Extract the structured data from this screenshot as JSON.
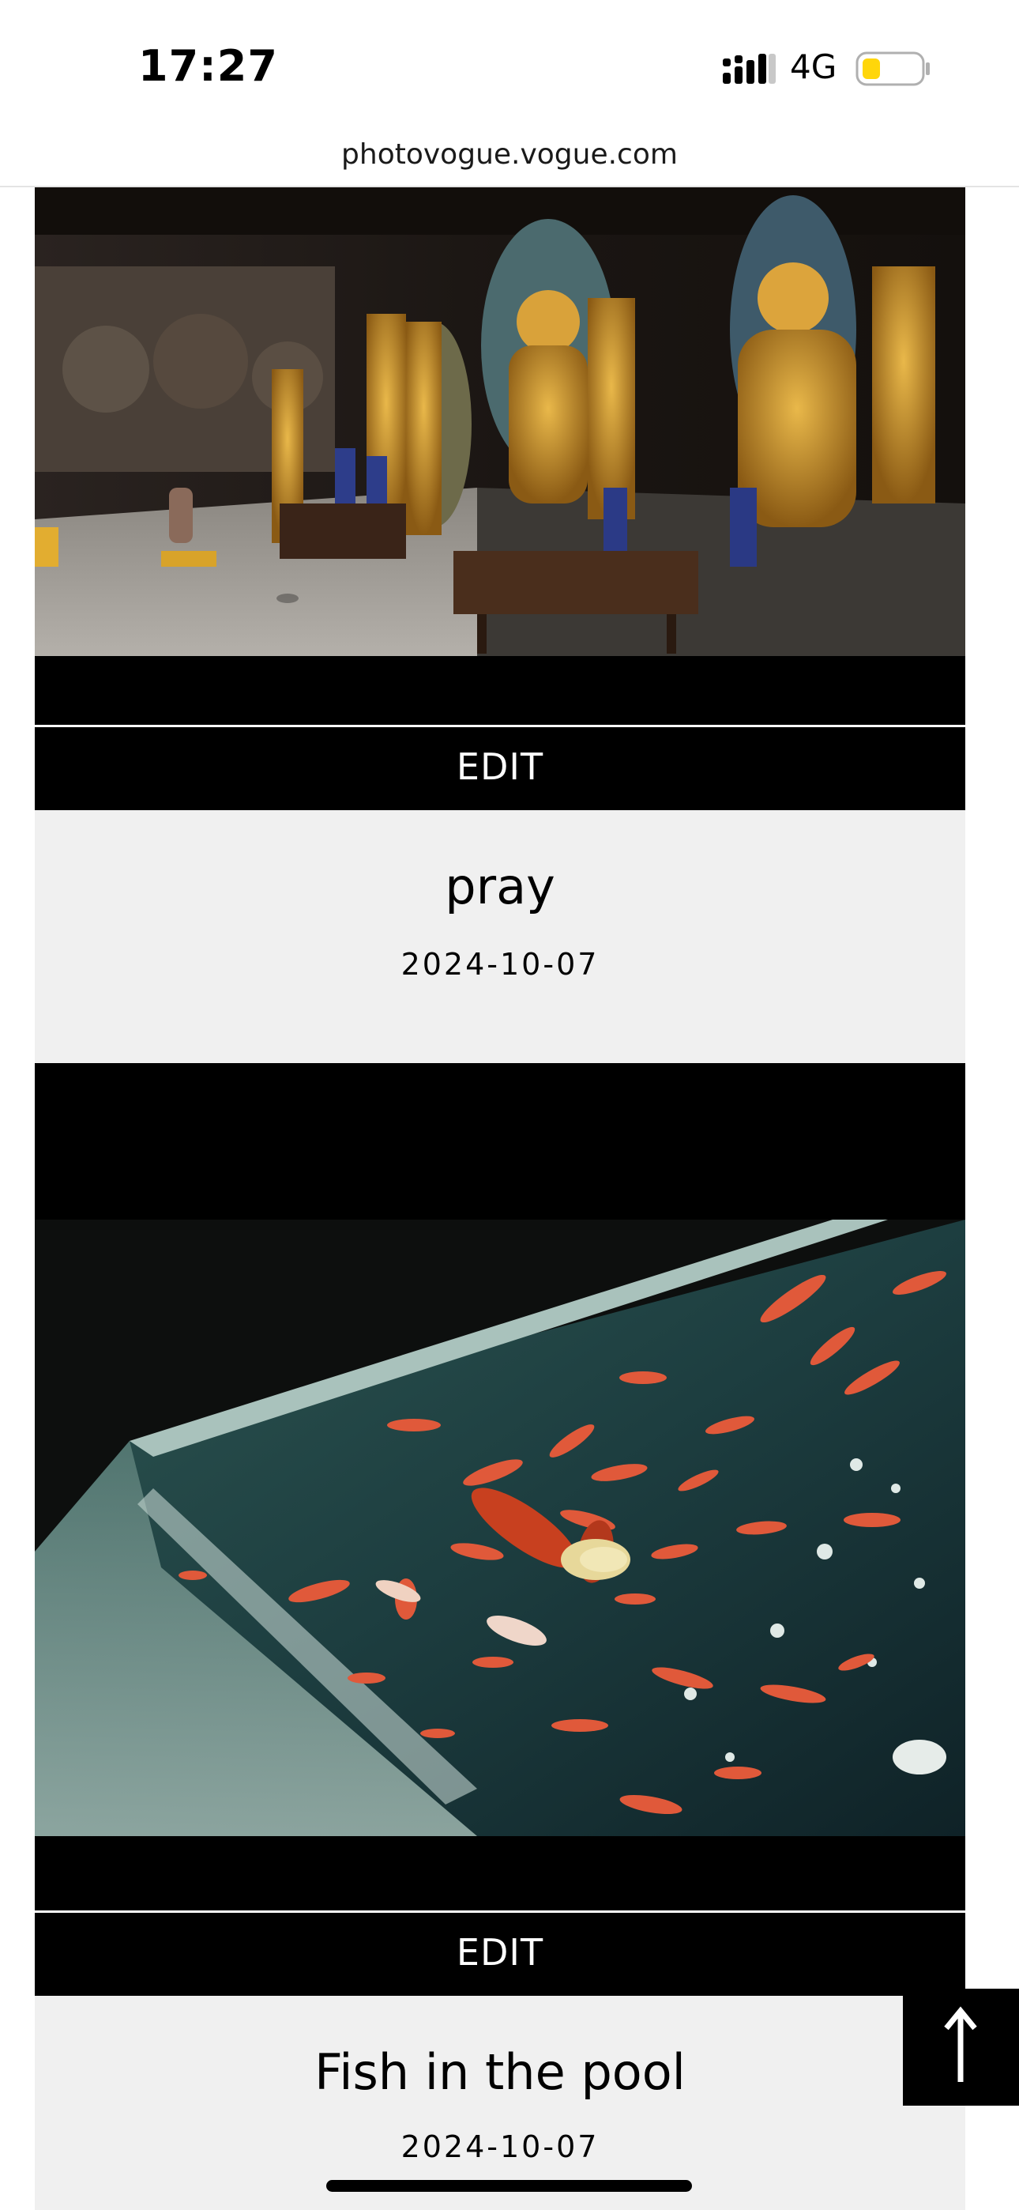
{
  "status_bar": {
    "time": "17:27",
    "network": "4G",
    "signal_icon": "cellular-signal-icon",
    "battery_icon": "battery-low-power-icon",
    "battery_color": "#ffd60a"
  },
  "browser": {
    "url": "photovogue.vogue.com"
  },
  "photos": [
    {
      "image_icon": "temple-buddha-statues-photo",
      "edit_label": "EDIT",
      "title": "pray",
      "date": "2024-10-07"
    },
    {
      "image_icon": "goldfish-tank-photo",
      "edit_label": "EDIT",
      "title": "Fish in the pool",
      "date": "2024-10-07"
    }
  ],
  "scroll_top": {
    "icon": "arrow-up-icon"
  }
}
